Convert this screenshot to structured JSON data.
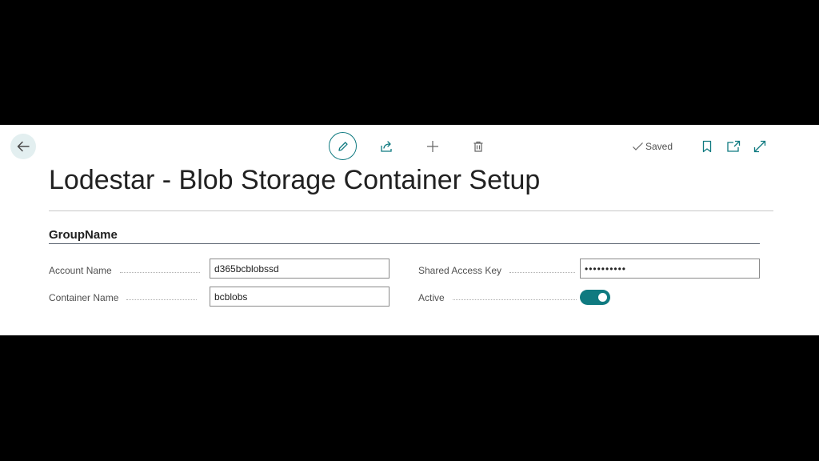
{
  "page": {
    "title": "Lodestar - Blob Storage Container Setup",
    "status": "Saved"
  },
  "icons": {
    "back": "arrow-left-icon",
    "edit": "pencil-icon",
    "share": "share-icon",
    "new": "plus-icon",
    "delete": "trash-icon",
    "saved": "checkmark-icon",
    "bookmark": "bookmark-icon",
    "popout": "open-new-window-icon",
    "expand": "expand-icon"
  },
  "group": {
    "name": "GroupName",
    "fields": {
      "account_name": {
        "label": "Account Name",
        "value": "d365bcblobssd"
      },
      "container_name": {
        "label": "Container Name",
        "value": "bcblobs"
      },
      "shared_access_key": {
        "label": "Shared Access Key",
        "value": "••••••••••"
      },
      "active": {
        "label": "Active",
        "value": true
      }
    }
  },
  "colors": {
    "accent": "#0f7a80",
    "back_button_bg": "#e3eff0",
    "text": "#212121",
    "label": "#505050"
  }
}
